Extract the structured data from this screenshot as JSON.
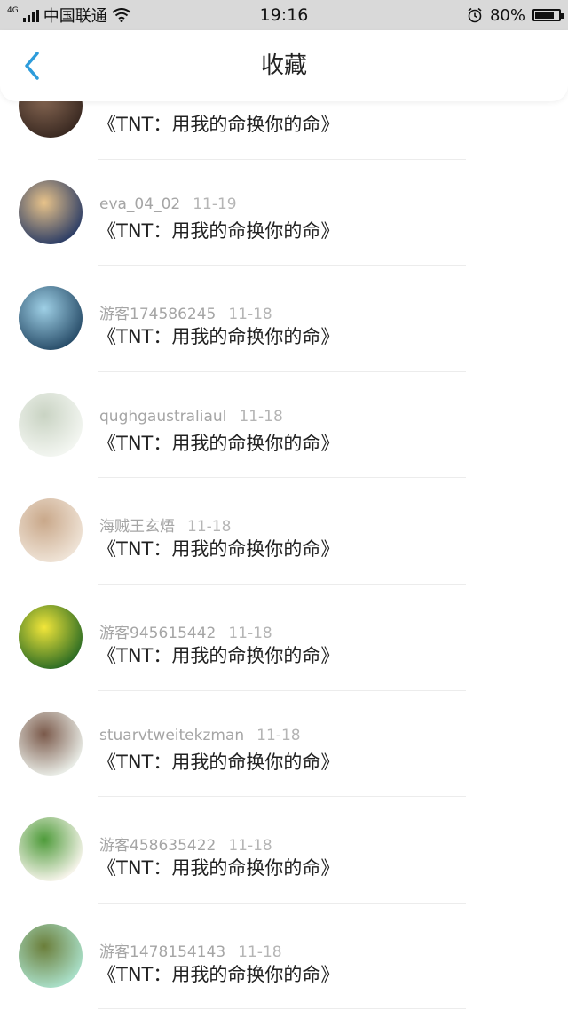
{
  "status_bar": {
    "network": "4G",
    "carrier": "中国联通",
    "time": "19:16",
    "battery": "80%",
    "battery_level": 0.8
  },
  "nav": {
    "title": "收藏",
    "back_icon": "chevron-left-icon"
  },
  "items": [
    {
      "user": "",
      "date": "",
      "title": "《TNT：用我的命换你的命》",
      "avatar_colors": [
        "#3b2a22",
        "#8a6a55"
      ]
    },
    {
      "user": "eva_04_02",
      "date": "11-19",
      "title": "《TNT：用我的命换你的命》",
      "avatar_colors": [
        "#2f3f66",
        "#e8c38a"
      ]
    },
    {
      "user": "游客174586245",
      "date": "11-18",
      "title": "《TNT：用我的命换你的命》",
      "avatar_colors": [
        "#2a4f6b",
        "#9fd0e6"
      ]
    },
    {
      "user": "qughgaustraliaul",
      "date": "11-18",
      "title": "《TNT：用我的命换你的命》",
      "avatar_colors": [
        "#f3f6f1",
        "#c9d3c3"
      ]
    },
    {
      "user": "海贼王玄焐",
      "date": "11-18",
      "title": "《TNT：用我的命换你的命》",
      "avatar_colors": [
        "#efe3d6",
        "#c9a88a"
      ]
    },
    {
      "user": "游客945615442",
      "date": "11-18",
      "title": "《TNT：用我的命换你的命》",
      "avatar_colors": [
        "#2f6e24",
        "#f2e63a"
      ]
    },
    {
      "user": "stuarvtweitekzman",
      "date": "11-18",
      "title": "《TNT：用我的命换你的命》",
      "avatar_colors": [
        "#e9ece6",
        "#7b5a4b"
      ]
    },
    {
      "user": "游客458635422",
      "date": "11-18",
      "title": "《TNT：用我的命换你的命》",
      "avatar_colors": [
        "#f6f4ea",
        "#4e9b3a"
      ]
    },
    {
      "user": "游客1478154143",
      "date": "11-18",
      "title": "《TNT：用我的命换你的命》",
      "avatar_colors": [
        "#a9dfc8",
        "#6b7e3a"
      ]
    }
  ]
}
